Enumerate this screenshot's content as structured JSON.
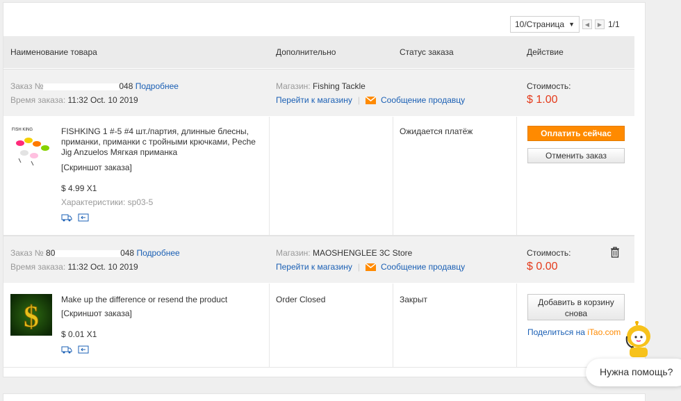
{
  "pager": {
    "per_page": "10/Страница",
    "page_count": "1/1"
  },
  "table_header": {
    "product": "Наименование товара",
    "extra": "Дополнительно",
    "status": "Статус заказа",
    "action": "Действие"
  },
  "orders": [
    {
      "order_label": "Заказ №",
      "order_number_tail": "048",
      "details_link": "Подробнее",
      "time_label": "Время заказа:",
      "time_value": "11:32 Oct. 10 2019",
      "store_label": "Магазин:",
      "store_name": "Fishing Tackle",
      "go_to_store": "Перейти к магазину",
      "message_seller": "Сообщение продавцу",
      "cost_label": "Стоимость:",
      "cost_value": "$ 1.00",
      "item": {
        "title": "FISHKING 1 #-5 #4 шт./партия, длинные блесны, приманки, приманки с тройными крючками, Peche Jig Anzuelos Мягкая приманка",
        "snapshot": "[Скриншот заказа]",
        "price_qty": "$ 4.99 X1",
        "specs": "Характеристики: sp03-5",
        "extra": "",
        "status": "Ожидается платёж",
        "thumb_text": "FISH KING"
      },
      "actions": {
        "primary": "Оплатить сейчас",
        "secondary": "Отменить заказ"
      }
    },
    {
      "order_label": "Заказ №",
      "order_number_head": "80",
      "order_number_tail": "048",
      "details_link": "Подробнее",
      "time_label": "Время заказа:",
      "time_value": "11:32 Oct. 10 2019",
      "store_label": "Магазин:",
      "store_name": "MAOSHENGLEE 3C Store",
      "go_to_store": "Перейти к магазину",
      "message_seller": "Сообщение продавцу",
      "cost_label": "Стоимость:",
      "cost_value": "$ 0.00",
      "item": {
        "title": "Make up the difference or resend the product",
        "snapshot": "[Скриншот заказа]",
        "price_qty": "$ 0.01 X1",
        "extra": "Order Closed",
        "status": "Закрыт",
        "thumb_text": "$"
      },
      "actions": {
        "secondary": "Добавить в корзину снова",
        "share": "Поделиться на",
        "share_brand": "iTao.com"
      }
    }
  ],
  "help": {
    "text": "Нужна помощь?"
  },
  "colors": {
    "accent": "#ff8a00",
    "price": "#e43a1b",
    "link": "#1a5fb4"
  }
}
